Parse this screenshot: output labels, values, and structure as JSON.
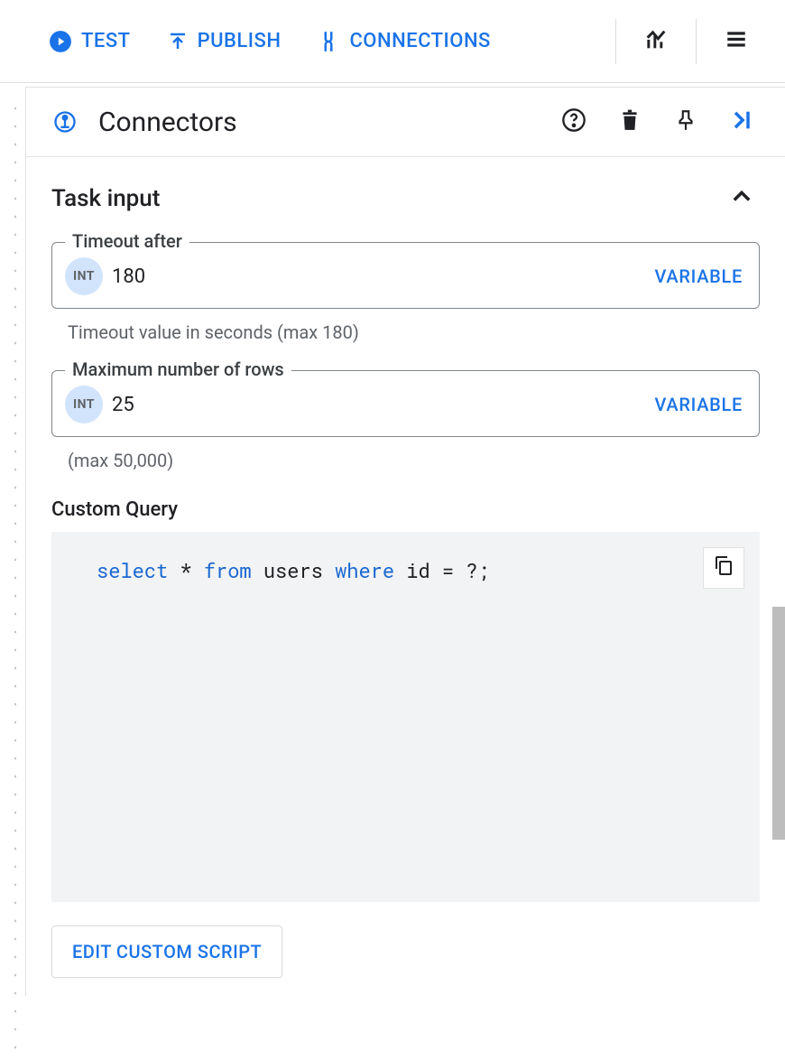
{
  "toolbar": {
    "test_label": "TEST",
    "publish_label": "PUBLISH",
    "connections_label": "CONNECTIONS"
  },
  "panel": {
    "title": "Connectors"
  },
  "task_input": {
    "section_label": "Task input",
    "timeout": {
      "legend": "Timeout after",
      "type_badge": "INT",
      "value": "180",
      "variable_label": "VARIABLE",
      "helper": "Timeout value in seconds (max 180)"
    },
    "max_rows": {
      "legend": "Maximum number of rows",
      "type_badge": "INT",
      "value": "25",
      "variable_label": "VARIABLE",
      "helper": "(max 50,000)"
    },
    "custom_query": {
      "label": "Custom Query",
      "sql_tokens": {
        "kw_select": "select",
        "star": "*",
        "kw_from": "from",
        "tbl": "users",
        "kw_where": "where",
        "col": "id",
        "rest": " = ?;"
      }
    },
    "edit_script_label": "EDIT CUSTOM SCRIPT"
  }
}
